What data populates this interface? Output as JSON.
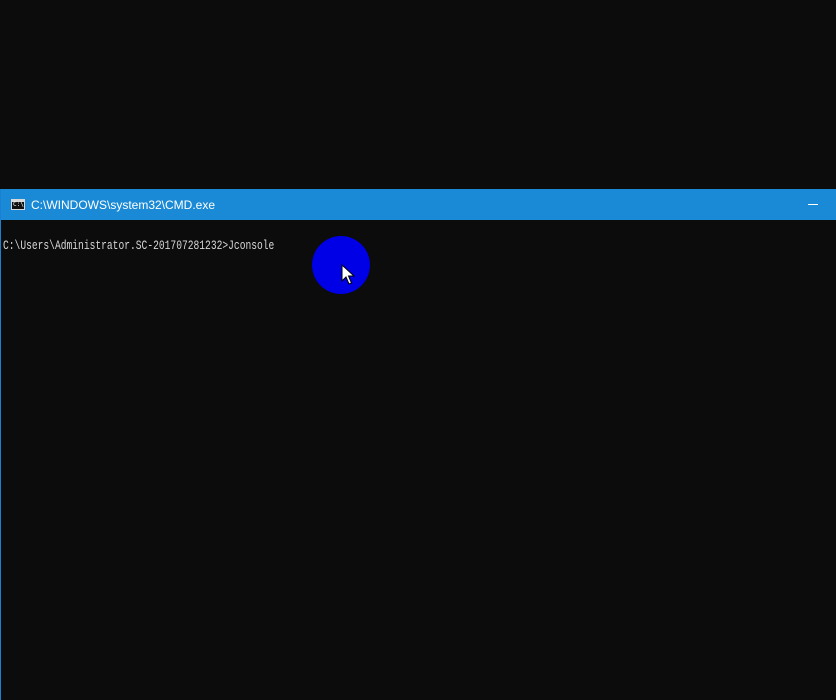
{
  "window": {
    "title": "C:\\WINDOWS\\system32\\CMD.exe",
    "icon": "cmd-app-icon",
    "icon_glyph": "C:\\",
    "controls": {
      "minimize_icon": "minimize-icon"
    }
  },
  "console": {
    "prompt": "C:\\Users\\Administrator.SC-201707281232>",
    "command": "Jconsole"
  },
  "colors": {
    "titlebar": "#1a8ad6",
    "console_background": "#0c0c0c",
    "console_text": "#d7d7d7",
    "cursor_highlight": "#0000e6"
  }
}
